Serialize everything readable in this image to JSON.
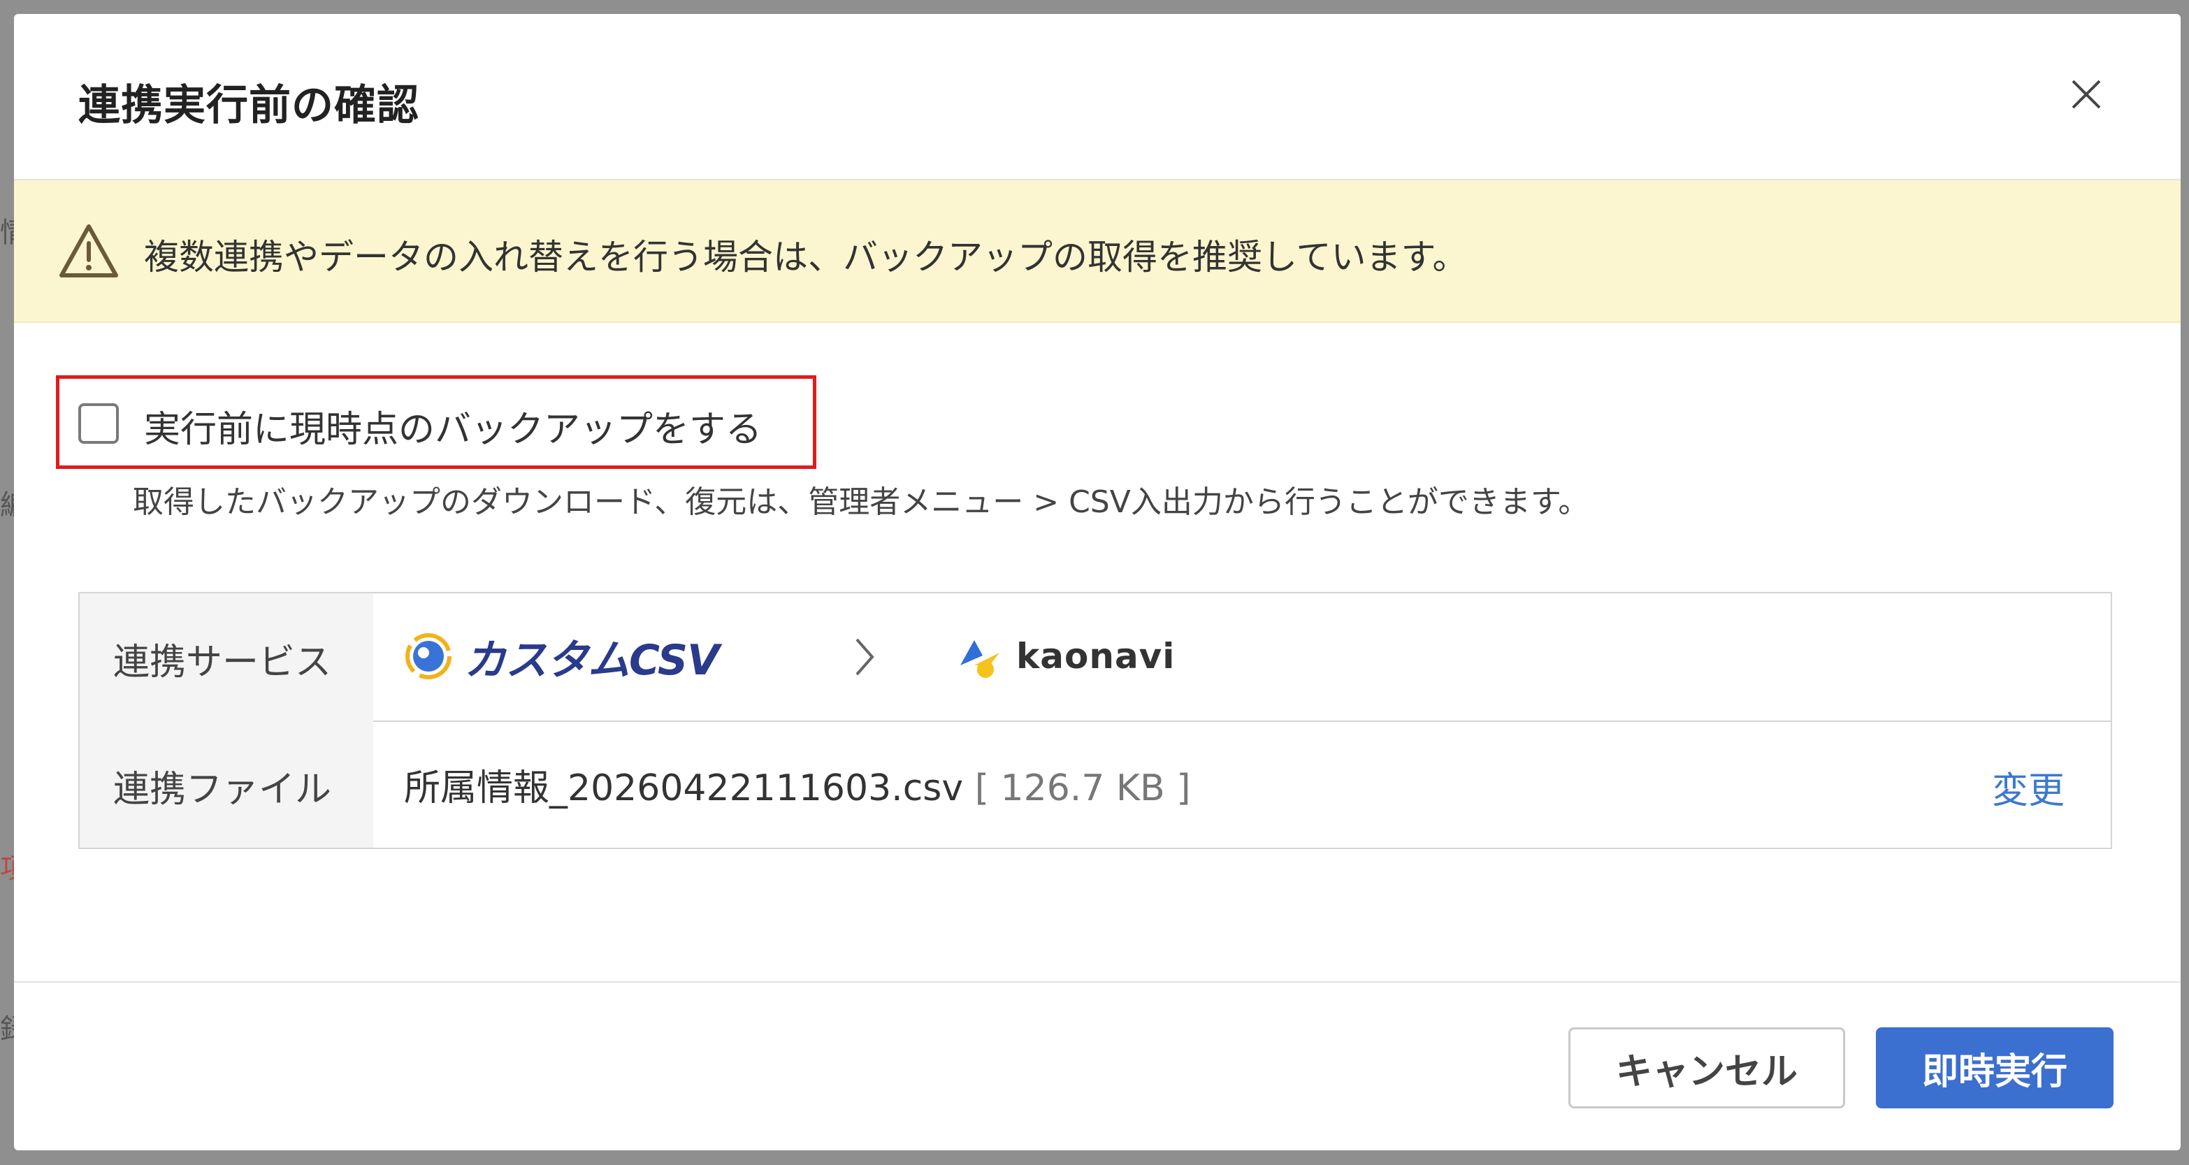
{
  "modal": {
    "title": "連携実行前の確認",
    "alert": {
      "message": "複数連携やデータの入れ替えを行う場合は、バックアップの取得を推奨しています。"
    },
    "backup": {
      "checked": false,
      "label": "実行前に現時点のバックアップをする",
      "help": "取得したバックアップのダウンロード、復元は、管理者メニュー > CSV入出力から行うことができます。"
    },
    "table": {
      "service_label": "連携サービス",
      "source_service": "カスタムCSV",
      "target_service": "kaonavi",
      "file_label": "連携ファイル",
      "file_name": "所属情報_20260422111603.csv",
      "file_size": "[ 126.7 KB ]",
      "change_link": "変更"
    },
    "buttons": {
      "cancel": "キャンセル",
      "run": "即時実行"
    }
  },
  "background": {
    "fragments": [
      "情",
      "編",
      "項",
      "「]",
      "録"
    ]
  },
  "colors": {
    "accent": "#3b6fd0",
    "alert_bg": "#fbf6cf",
    "highlight_border": "#e21b1b",
    "link": "#3b78d1"
  }
}
